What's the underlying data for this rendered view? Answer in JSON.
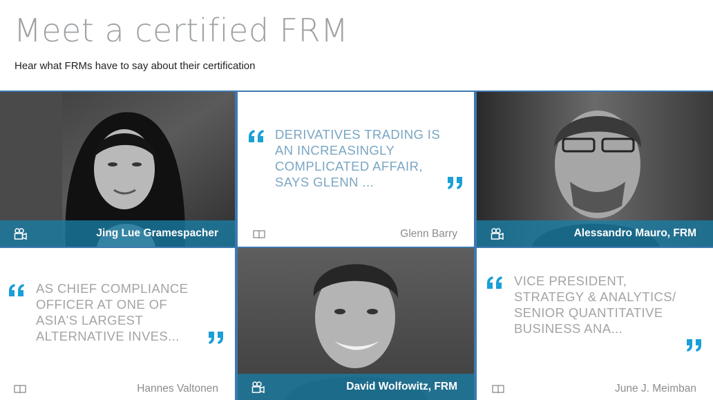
{
  "header": {
    "title": "Meet a certified FRM",
    "subtitle": "Hear what FRMs have to say about their certification"
  },
  "tiles": [
    {
      "type": "video",
      "name": "Jing Lue Gramespacher",
      "icon": "video-camera-icon"
    },
    {
      "type": "quote",
      "text": "DERIVATIVES TRADING IS AN INCREASINGLY COMPLICATED AFFAIR, SAYS GLENN ...",
      "author": "Glenn Barry",
      "icon": "book-icon"
    },
    {
      "type": "video",
      "name": "Alessandro Mauro, FRM",
      "icon": "video-camera-icon"
    },
    {
      "type": "quote",
      "text": "AS CHIEF COMPLIANCE OFFICER AT ONE OF ASIA'S LARGEST ALTERNATIVE INVES...",
      "author": "Hannes Valtonen",
      "icon": "book-icon"
    },
    {
      "type": "video",
      "name": "David Wolfowitz, FRM",
      "icon": "video-camera-icon"
    },
    {
      "type": "quote",
      "text": "VICE PRESIDENT, STRATEGY & ANALYTICS/ SENIOR QUANTITATIVE BUSINESS ANA...",
      "author": "June J. Meimban",
      "icon": "book-icon"
    }
  ],
  "colors": {
    "accent": "#1a9fd6",
    "quote_text": "#7aa6c3",
    "caption_bar": "#197da5",
    "grid_border": "#3d79b0"
  }
}
